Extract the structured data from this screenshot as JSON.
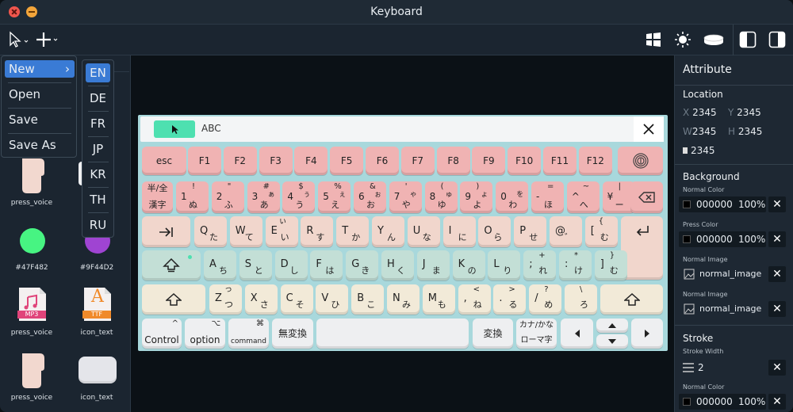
{
  "window": {
    "title": "Keyboard"
  },
  "menu": {
    "items": [
      "New",
      "Open",
      "Save",
      "Save As"
    ],
    "submenu_arrow": "›"
  },
  "submenu": {
    "items": [
      "EN",
      "DE",
      "FR",
      "JP",
      "KR",
      "TH",
      "RU"
    ]
  },
  "assets": [
    {
      "label": "press_voice"
    },
    {
      "label": "#47F482",
      "color": "#47F482"
    },
    {
      "label": "#9F44D2",
      "color": "#9F44D2"
    },
    {
      "label": "press_voice",
      "badge": "MP3"
    },
    {
      "label": "icon_text",
      "badge": "TTF",
      "glyph": "A"
    },
    {
      "label": "press_voice"
    },
    {
      "label": "icon_text"
    }
  ],
  "keyboard": {
    "bar_text": "ABC",
    "fn_row": [
      "esc",
      "F1",
      "F2",
      "F3",
      "F4",
      "F5",
      "F6",
      "F7",
      "F8",
      "F9",
      "F10",
      "F11",
      "F12"
    ],
    "num_row": [
      {
        "top": "!",
        "bl": "1",
        "br": "ぬ"
      },
      {
        "top": "\"",
        "bl": "2",
        "br": "ふ"
      },
      {
        "top": "#",
        "bl": "3",
        "br": "あ",
        "tr": "ぁ"
      },
      {
        "top": "$",
        "bl": "4",
        "br": "う",
        "tr": "ぅ"
      },
      {
        "top": "%",
        "bl": "5",
        "br": "え",
        "tr": "ぇ"
      },
      {
        "top": "&",
        "bl": "6",
        "br": "お",
        "tr": "ぉ"
      },
      {
        "top": "'",
        "bl": "7",
        "br": "や",
        "tr": "ゃ"
      },
      {
        "top": "(",
        "bl": "8",
        "br": "ゆ",
        "tr": "ゅ"
      },
      {
        "top": ")",
        "bl": "9",
        "br": "よ",
        "tr": "ょ"
      },
      {
        "top": "",
        "bl": "0",
        "br": "わ",
        "tr": "を"
      },
      {
        "top": "=",
        "bl": "-",
        "br": "ほ"
      },
      {
        "top": "~",
        "bl": "^",
        "br": "へ"
      },
      {
        "top": "|",
        "bl": "¥",
        "br": "ー"
      }
    ],
    "hankaku": [
      "半/全",
      "漢字"
    ],
    "q_row": [
      {
        "l": "Q",
        "k": "た"
      },
      {
        "l": "W",
        "k": "て"
      },
      {
        "l": "E",
        "k": "い",
        "tk": "ぃ"
      },
      {
        "l": "R",
        "k": "す"
      },
      {
        "l": "T",
        "k": "か"
      },
      {
        "l": "Y",
        "k": "ん"
      },
      {
        "l": "U",
        "k": "な"
      },
      {
        "l": "I",
        "k": "に"
      },
      {
        "l": "O",
        "k": "ら"
      },
      {
        "l": "P",
        "k": "せ"
      },
      {
        "l": "@",
        "k": "゛"
      },
      {
        "l": "[",
        "k": "む",
        "tk": "{"
      }
    ],
    "a_row": [
      {
        "l": "A",
        "k": "ち"
      },
      {
        "l": "S",
        "k": "と"
      },
      {
        "l": "D",
        "k": "し"
      },
      {
        "l": "F",
        "k": "は"
      },
      {
        "l": "G",
        "k": "き"
      },
      {
        "l": "H",
        "k": "く"
      },
      {
        "l": "J",
        "k": "ま"
      },
      {
        "l": "K",
        "k": "の"
      },
      {
        "l": "L",
        "k": "り"
      },
      {
        "l": ";",
        "k": "れ",
        "tk": "+"
      },
      {
        "l": ":",
        "k": "け",
        "tk": "*"
      },
      {
        "l": "]",
        "k": "む",
        "tk": "}"
      }
    ],
    "z_row": [
      {
        "l": "Z",
        "k": "つ",
        "tk": "っ"
      },
      {
        "l": "X",
        "k": "さ"
      },
      {
        "l": "C",
        "k": "そ"
      },
      {
        "l": "V",
        "k": "ひ"
      },
      {
        "l": "B",
        "k": "こ"
      },
      {
        "l": "N",
        "k": "み"
      },
      {
        "l": "M",
        "k": "も"
      },
      {
        "l": ",",
        "k": "ね",
        "tk": "<"
      },
      {
        "l": ".",
        "k": "る",
        "tk": ">"
      },
      {
        "l": "/",
        "k": "め",
        "tk": "?"
      },
      {
        "l": "",
        "k": "ろ",
        "tk": "\\"
      }
    ],
    "bottom": {
      "control": "Control",
      "option": "option",
      "command": "command",
      "muhenkan": "無変換",
      "henkan": "変換",
      "kana1": "カナ/かな",
      "kana2": "ローマ字"
    }
  },
  "attribute": {
    "title": "Attribute",
    "location": {
      "title": "Location",
      "x_label": "X",
      "x": "2345",
      "y_label": "Y",
      "y": "2345",
      "w_label": "W",
      "w": "2345",
      "h_label": "H",
      "h": "2345",
      "r": "2345"
    },
    "background": {
      "title": "Background",
      "normal_color_label": "Normal Color",
      "normal_hex": "000000",
      "normal_pct": "100%",
      "press_color_label": "Press Color",
      "press_hex": "000000",
      "press_pct": "100%",
      "normal_image_label": "Normal Image",
      "normal_image": "normal_image",
      "normal_image_label2": "Normal Image",
      "normal_image2": "normal_image"
    },
    "stroke": {
      "title": "Stroke",
      "width_label": "Stroke Width",
      "width": "2",
      "color_label": "Normal Color",
      "hex": "000000",
      "pct": "100%"
    }
  },
  "colors": {
    "accent": "#3a7bd5",
    "green_btn": "#4ee0b0"
  }
}
